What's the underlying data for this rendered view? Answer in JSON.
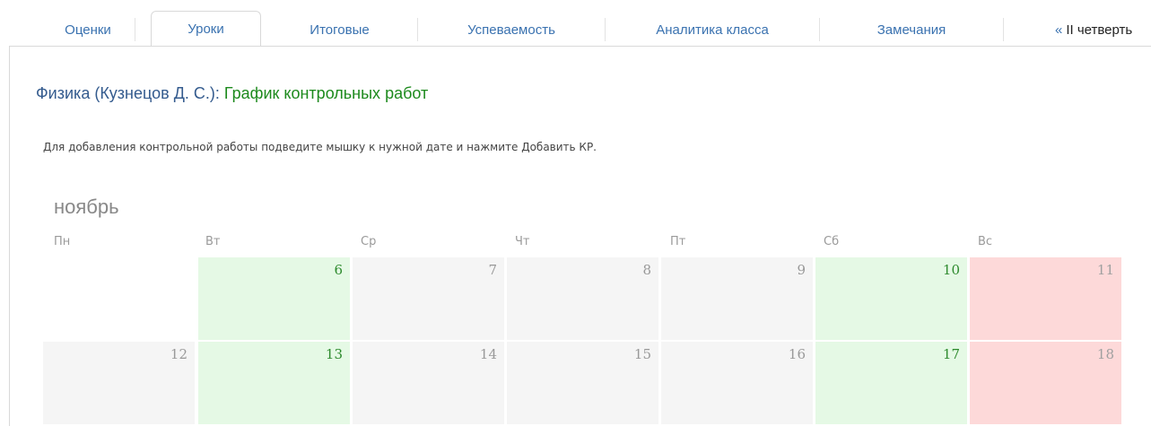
{
  "tabs": [
    {
      "label": "Оценки"
    },
    {
      "label": "Уроки",
      "active": true
    },
    {
      "label": "Итоговые"
    },
    {
      "label": "Успеваемость"
    },
    {
      "label": "Аналитика класса"
    },
    {
      "label": "Замечания"
    }
  ],
  "quarter_link": {
    "arrows": "«",
    "label": "II четверть"
  },
  "heading": {
    "subject": "Физика (Кузнецов Д. С.):",
    "title": "График контрольных работ"
  },
  "hint": "Для добавления контрольной работы подведите мышку к нужной дате и нажмите Добавить КР.",
  "calendar": {
    "month": "ноябрь",
    "weekdays": [
      "Пн",
      "Вт",
      "Ср",
      "Чт",
      "Пт",
      "Сб",
      "Вс"
    ],
    "weeks": [
      [
        {
          "day": "",
          "status": "empty"
        },
        {
          "day": "6",
          "status": "green"
        },
        {
          "day": "7",
          "status": "gray"
        },
        {
          "day": "8",
          "status": "gray"
        },
        {
          "day": "9",
          "status": "gray"
        },
        {
          "day": "10",
          "status": "green"
        },
        {
          "day": "11",
          "status": "red"
        }
      ],
      [
        {
          "day": "12",
          "status": "gray"
        },
        {
          "day": "13",
          "status": "green"
        },
        {
          "day": "14",
          "status": "gray"
        },
        {
          "day": "15",
          "status": "gray"
        },
        {
          "day": "16",
          "status": "gray"
        },
        {
          "day": "17",
          "status": "green"
        },
        {
          "day": "18",
          "status": "red"
        }
      ]
    ]
  },
  "colors": {
    "link": "#3a72b0",
    "green_day": "#e5f9e5",
    "red_day": "#fdd9d9",
    "gray_day": "#f5f5f5"
  }
}
